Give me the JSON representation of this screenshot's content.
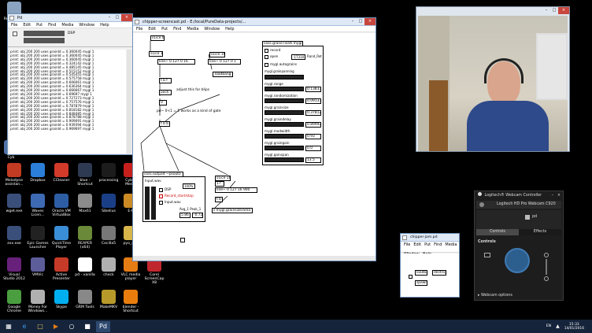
{
  "desktop": {
    "icons": [
      {
        "label": "Recycle Bin",
        "color": "#8aa3c0"
      },
      {
        "label": "Cyb",
        "color": "#4f72a8"
      },
      {
        "label": "Melodyne assistan...",
        "color": "#c23b22"
      },
      {
        "label": "Dropbox",
        "color": "#2b7fd8"
      },
      {
        "label": "CCleaner",
        "color": "#d23a2a"
      },
      {
        "label": "blue - Shortcut",
        "color": "#2e3a52"
      },
      {
        "label": "processing",
        "color": "#1c1c1c"
      },
      {
        "label": "Cyber Media",
        "color": "#c7201c"
      },
      {
        "label": "wget.exe",
        "color": "#3a4f7a"
      },
      {
        "label": "Waves Licen...",
        "color": "#3d6ab2"
      },
      {
        "label": "Oracle VM VirtualBox",
        "color": "#2d5ea3"
      },
      {
        "label": "Max61",
        "color": "#8c8c8c"
      },
      {
        "label": "Sibelius",
        "color": "#1b3f86"
      },
      {
        "label": "E-P",
        "color": "#cc8a24"
      },
      {
        "label": "zxx.exe",
        "color": "#3a4f7a"
      },
      {
        "label": "Epic Games Launcher",
        "color": "#222222"
      },
      {
        "label": "QuickTime Player",
        "color": "#3a8ed6"
      },
      {
        "label": "REAPER (x64)",
        "color": "#6a8a3a"
      },
      {
        "label": "CecilIa5",
        "color": "#777777"
      },
      {
        "label": "pyo_exa",
        "color": "#d8b54a"
      },
      {
        "label": "Visual Studio 2012",
        "color": "#68217a"
      },
      {
        "label": "VMVic",
        "color": "#5d5d9a"
      },
      {
        "label": "Active Presenter",
        "color": "#c63a28"
      },
      {
        "label": "pd - vanilla",
        "color": "#ffffff"
      },
      {
        "label": "check",
        "color": "#b0b0b0"
      },
      {
        "label": "VLC media player",
        "color": "#e57c14"
      },
      {
        "label": "Corel ScreenCap X8",
        "color": "#c0272d"
      },
      {
        "label": "Google Chrome",
        "color": "#4a9e3f"
      },
      {
        "label": "Money For Windows...",
        "color": "#b0b0b0"
      },
      {
        "label": "Skype",
        "color": "#00aff0"
      },
      {
        "label": "GRM Tools",
        "color": "#888888"
      },
      {
        "label": "MakeMKV",
        "color": "#b89a2a"
      },
      {
        "label": "blender - Shortcut",
        "color": "#e87d0d"
      }
    ]
  },
  "console_window": {
    "title": "Pd",
    "menu": [
      "File",
      "Edit",
      "Put",
      "Find",
      "Media",
      "Window",
      "Help"
    ],
    "dsp_label": "DSP",
    "lines": [
      "print: obj 200 200 uses grainId = 0.360045 mygl 1",
      "print: obj 200 200 uses grainId = 0.360045 mygl 1",
      "print: obj 200 200 uses grainId = 0.360045 mygl 1",
      "print: obj 200 200 uses grainId = 0.324142 mygl 1",
      "print: obj 200 200 uses grainId = 0.485145 mygl 1",
      "print: obj 200 200 uses grainId = 0.515152 mygl 1",
      "print: obj 200 200 uses grainId = 0.545455 mygl 1",
      "print: obj 200 200 uses grainId = 0.575758 mygl 1",
      "print: obj 200 200 uses grainId = 0.606061 mygl 1",
      "print: obj 200 200 uses grainId = 0.636364 mygl 1",
      "print: obj 200 200 uses grainId = 0.666667 mygl 1",
      "print: obj 200 200 uses grainId = 0.69697 mygl 1",
      "print: obj 200 200 uses grainId = 0.727273 mygl 1",
      "print: obj 200 200 uses grainId = 0.757576 mygl 1",
      "print: obj 200 200 uses grainId = 0.787879 mygl 1",
      "print: obj 200 200 uses grainId = 0.818182 mygl 1",
      "print: obj 200 200 uses grainId = 0.848485 mygl 1",
      "print: obj 200 200 uses grainId = 0.878788 mygl 1",
      "print: obj 200 200 uses grainId = 0.909091 mygl 1",
      "print: obj 200 200 uses grainId = 0.939394 mygl 1",
      "print: obj 200 200 uses grainId = 0.969697 mygl 1"
    ]
  },
  "pd_main": {
    "title": "chipper-screencast.pd - E:/local/PureData-projects/...",
    "menu": [
      "File",
      "Edit",
      "Put",
      "Find",
      "Media",
      "Window",
      "Help"
    ],
    "objects": {
      "o1": "s1ice 0",
      "o2": "s1ice 1",
      "o3": "line~ 0 127 0 16",
      "o4": "s1ice 16",
      "o5": "line~ 0 127 0 1",
      "o6": "loadbang",
      "o7": "t b f",
      "o8": "pack",
      "o9": "0",
      "o10": "t b b",
      "o11": "coss.grane7ionK mygl",
      "o12": "coss.outpalt ~psouto",
      "o13": "s1ice 16",
      "o14": "line~ 0 127 16 900",
      "o15": "t b",
      "o16": "s mygl.grainsize/area"
    },
    "comments": {
      "c1": "adjust this for blips",
      "c2": "pd~ 0<1 = 1 works as a kind of gate",
      "c3": "Rand_Rot",
      "c4": "mygl.range",
      "c5": "mygl.randomization",
      "c6": "mygl.grainsize",
      "c7": "mygl.graindelay",
      "c8": "mygl.modwidth",
      "c9": "mygl.graingain",
      "c10": "mygl.gainspan",
      "c11": "Avg_1 Peak_1"
    },
    "toggles": {
      "t1": "record",
      "t2": "open",
      "t3": "mygl.autograins",
      "t4": "mygl.grainpanning"
    },
    "numbers": {
      "n1": "0.13833",
      "n2": "0.09133",
      "n3": "0.37812",
      "n4": "0.89992",
      "n5": "0.93",
      "n6": "0.0",
      "n7": "13.5",
      "n8": "-173101",
      "n9": "100%",
      "n10": "5.86",
      "n11": "-0.72",
      "n12": "17",
      "n13": "1"
    },
    "subpanel": {
      "label1": "Input.wav",
      "label2": "DSP",
      "label3": "Record_start/stop",
      "label4": "Input.wav"
    }
  },
  "webcam": {
    "title": "Logitech HD Pro Webcam C920"
  },
  "small_pd": {
    "title": "chipper-jam.pd",
    "menu": [
      "File",
      "Edit",
      "Put",
      "Find",
      "Media",
      "Window",
      "Help"
    ],
    "objects": {
      "a": "loadbang",
      "b": "destroy",
      "c": "spewrite"
    }
  },
  "logitech": {
    "header": "Logitech® Webcam Controller",
    "device": "Logitech HD Pro Webcam C920",
    "user_row": "pd",
    "tab_controls": "Controls",
    "tab_effects": "Effects",
    "section": "Controls",
    "options": "Webcam options"
  },
  "taskbar": {
    "lang": "EN",
    "time": "15:33",
    "date": "14/01/2016"
  }
}
